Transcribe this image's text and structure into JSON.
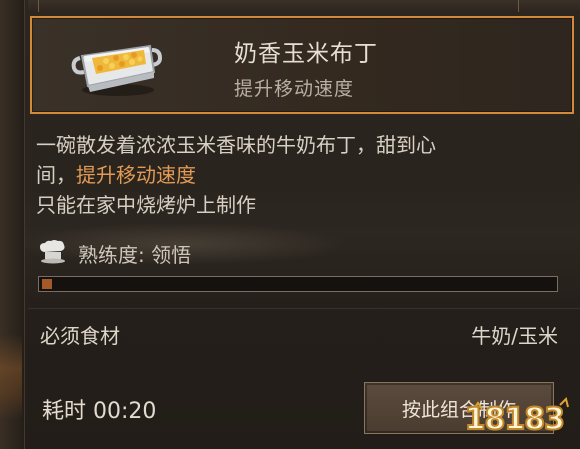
{
  "item": {
    "name": "奶香玉米布丁",
    "effect": "提升移动速度",
    "icon": "corn-pudding-dish-icon"
  },
  "description": {
    "line1": "一碗散发着浓浓玉米香味的牛奶布丁，甜到心",
    "line2_prefix": "间，",
    "line2_highlight": "提升移动速度",
    "line3": "只能在家中烧烤炉上制作"
  },
  "mastery": {
    "icon": "chef-hat-icon",
    "label": "熟练度: 领悟",
    "progress_fraction": 0.02
  },
  "ingredients": {
    "label": "必须食材",
    "value": "牛奶/玉米"
  },
  "time": {
    "label": "耗时 00:20"
  },
  "craft_button": {
    "label": "按此组合制作"
  },
  "watermark": {
    "text": "18183"
  },
  "colors": {
    "accent_border": "#d28a3a",
    "highlight_text": "#e29a54",
    "progress_fill": "#a35a28"
  }
}
